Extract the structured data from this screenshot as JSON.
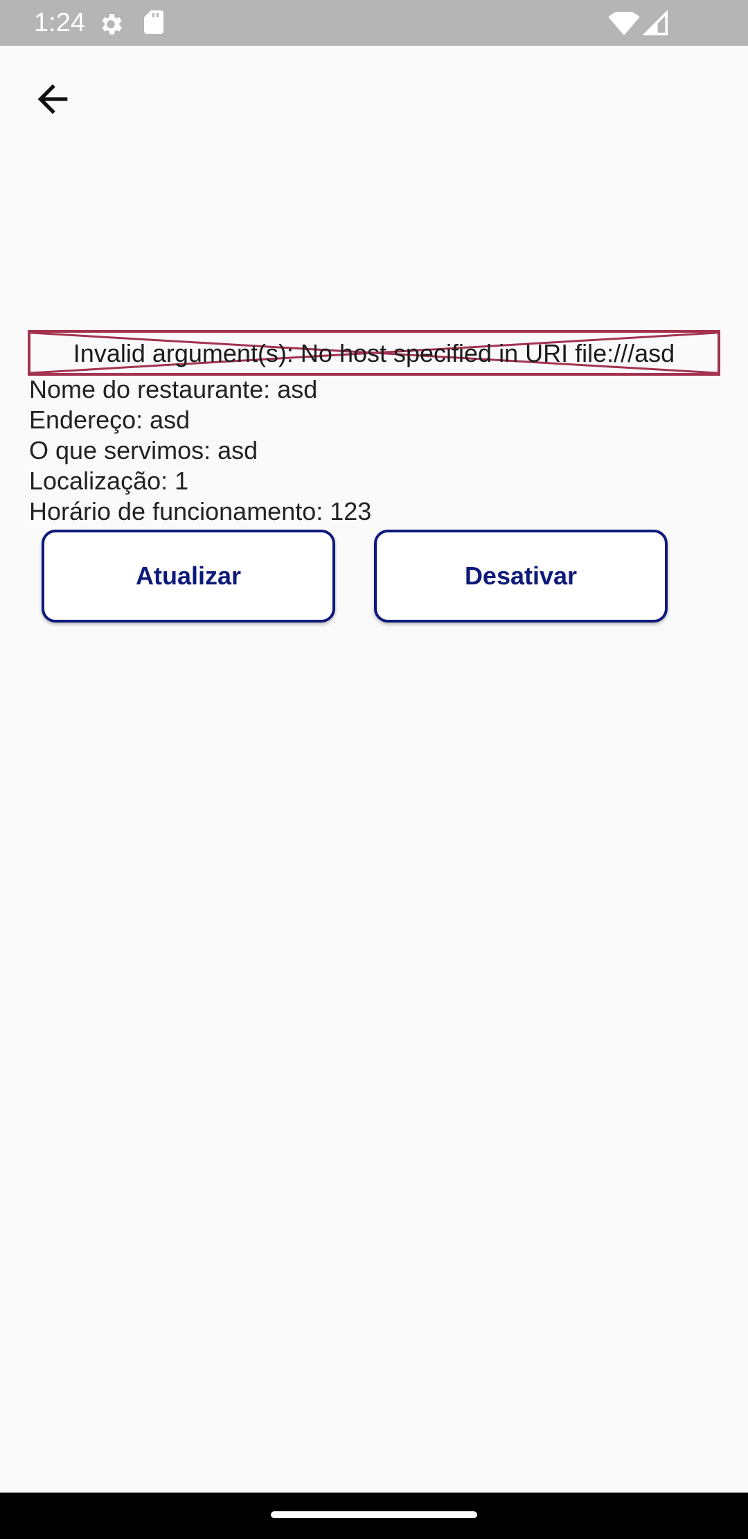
{
  "status_bar": {
    "time": "1:24",
    "icons": [
      "gear-icon",
      "sd-card-icon",
      "wifi-icon",
      "signal-icon"
    ]
  },
  "app_bar": {
    "back_icon": "arrow-back-icon"
  },
  "image_error": {
    "message": "Invalid argument(s): No host specified in URI file:///asd",
    "border_color": "#a3334f"
  },
  "details": {
    "name": "Nome do restaurante: asd",
    "address": "Endereço: asd",
    "serves": "O que servimos: asd",
    "location": "Localização: 1",
    "hours": "Horário de funcionamento: 123"
  },
  "actions": {
    "update_label": "Atualizar",
    "deactivate_label": "Desativar",
    "accent_color": "#0d1a7a"
  }
}
